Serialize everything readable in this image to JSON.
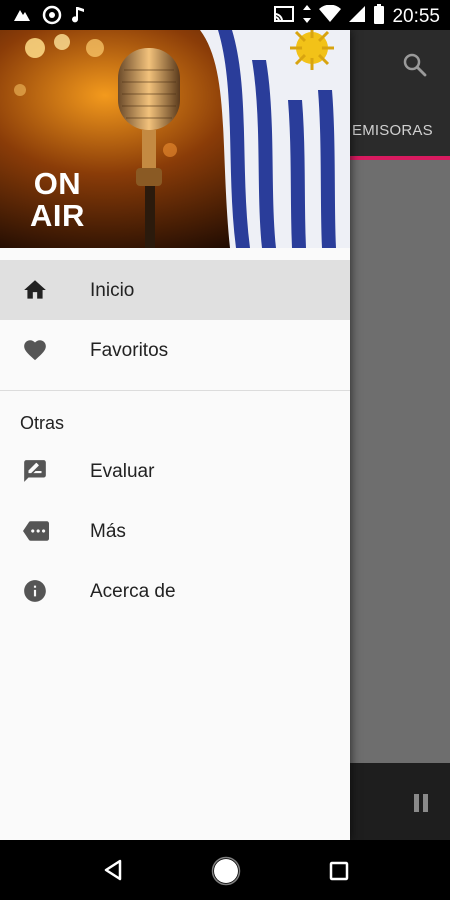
{
  "status_bar": {
    "time": "20:55",
    "left_icons": [
      "cloud-icon",
      "camera-aperture-icon",
      "music-note-icon"
    ],
    "right_icons": [
      "cast-icon",
      "data-arrows-icon",
      "wifi-icon",
      "signal-icon",
      "battery-icon"
    ]
  },
  "background_app": {
    "tab_label": "EMISORAS",
    "accent_color": "#d81b60",
    "search_icon": "search-icon",
    "pause_icon": "pause-icon"
  },
  "drawer": {
    "header": {
      "badge_line1": "ON",
      "badge_line2": "AIR",
      "image": "microphone-and-uruguay-flag"
    },
    "items": [
      {
        "label": "Inicio",
        "icon": "home-icon",
        "selected": true
      },
      {
        "label": "Favoritos",
        "icon": "heart-icon",
        "selected": false
      }
    ],
    "section_label": "Otras",
    "other_items": [
      {
        "label": "Evaluar",
        "icon": "rate-review-icon"
      },
      {
        "label": "Más",
        "icon": "more-label-icon"
      },
      {
        "label": "Acerca de",
        "icon": "info-icon"
      }
    ]
  },
  "nav_bar": {
    "back_icon": "back-icon",
    "home_icon": "home-circle-icon",
    "recents_icon": "recents-icon"
  }
}
